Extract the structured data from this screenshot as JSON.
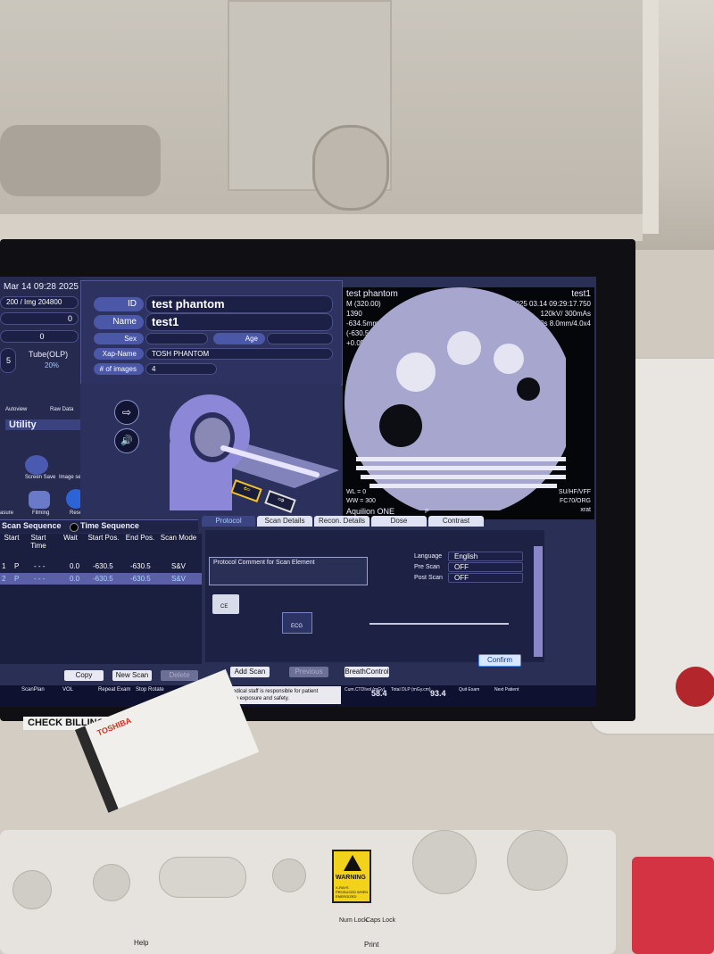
{
  "header": {
    "datetime": "Mar 14 09:28 2025",
    "mas_readout": "200 / Img 204800",
    "counter_a": "0",
    "counter_b": "0",
    "counter_c": "5",
    "tube_label": "Tube(OLP)",
    "tube_value": "20%"
  },
  "left_tools": {
    "autoview": "Autoview",
    "rawdata": "Raw Data",
    "utility": "Utility",
    "screen_save": "Screen Save",
    "image_selector": "Image selector",
    "measure": "asure",
    "filming": "Filming",
    "reset": "Reset"
  },
  "patient": {
    "id_label": "ID",
    "id_value": "test phantom",
    "name_label": "Name",
    "name_value": "test1",
    "sex_label": "Sex",
    "age_label": "Age",
    "xap_label": "Xap-Name",
    "xap_value": "TOSH PHANTOM",
    "images_label": "# of images",
    "images_value": "4"
  },
  "preview": {
    "name": "test phantom",
    "id": "test1",
    "left_lines": [
      "M (320.00)",
      "1390",
      "-634.5mm",
      "(-630.5mm)",
      "+0.0D"
    ],
    "right_lines": [
      "2025 03.14 09:29:17.750",
      "120kV/ 300mAs",
      "1.0s 8.0mm/4.0x4"
    ],
    "wl": "WL = 0",
    "ww": "WW = 300",
    "scanner": "Aquilion ONE",
    "bottom_right": [
      "SU/HF/VFF",
      "FC70/ORG",
      "xrat"
    ],
    "p_label": "P"
  },
  "sequence": {
    "title": "Scan Sequence",
    "time_seq": "Time Sequence",
    "columns": [
      "Start",
      "Start Time",
      "Wait",
      "Start Pos.",
      "End Pos.",
      "Scan Mode"
    ],
    "rows": [
      {
        "n": "1",
        "mode_a": "P",
        "start": "- - -",
        "wait": "0.0",
        "start_pos": "-630.5",
        "end_pos": "-630.5",
        "scan_mode": "S&V"
      },
      {
        "n": "2",
        "mode_a": "P",
        "start": "- - -",
        "wait": "0.0",
        "start_pos": "-630.5",
        "end_pos": "-630.5",
        "scan_mode": "S&V"
      }
    ]
  },
  "tabs": [
    "Protocol",
    "Scan Details",
    "Recon. Details",
    "Dose",
    "Contrast"
  ],
  "protocol": {
    "comment_label": "Protocol Comment for Scan Element",
    "language_label": "Language",
    "language_value": "English",
    "prescan_label": "Pre Scan",
    "prescan_value": "OFF",
    "postscan_label": "Post Scan",
    "postscan_value": "OFF",
    "ce_label": "CE",
    "ecg_label": "ECG"
  },
  "buttons": {
    "copy": "Copy",
    "new_scan": "New Scan",
    "delete": "Delete",
    "add_scan": "Add Scan",
    "previous": "Previous",
    "breath_control": "BreathControl",
    "confirm": "Confirm"
  },
  "status": {
    "scan_plan": "ScanPlan",
    "vol": "VOL",
    "repeat_exam": "Repeat Exam",
    "stop_rotate": "Stop Rotate",
    "notice": "The Medical staff is responsible for patient radiation exposure and safety.",
    "ctdi_label": "Cum.CTDIvol (mGy)",
    "ctdi_value": "58.4",
    "dlp_label": "Total DLP (mGy.cm)",
    "dlp_value": "93.4",
    "quit_exam": "Quit Exam",
    "next_patient": "Next Patient"
  },
  "desk": {
    "billing": "CHECK BILLING!!!",
    "card_brand": "TOSHIBA",
    "warning": "WARNING",
    "warning_sub": "X-RAYS PRODUCED WHEN ENERGIZED",
    "num_lock": "Num Lock",
    "caps_lock": "Caps Lock",
    "help": "Help",
    "print": "Print"
  }
}
